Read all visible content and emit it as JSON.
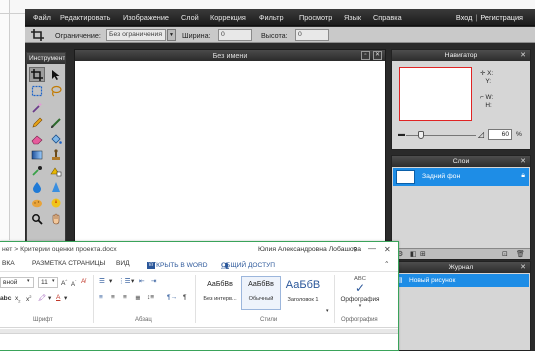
{
  "editor": {
    "menu": [
      "Файл",
      "Редактировать",
      "Изображение",
      "Слой",
      "Коррекция",
      "Фильтр",
      "Просмотр",
      "Язык",
      "Справка"
    ],
    "login": "Вход",
    "register": "Регистрация",
    "options": {
      "constraint_label": "Ограничение:",
      "constraint_value": "Без ограничения",
      "width_label": "Ширина:",
      "width_value": "0",
      "height_label": "Высота:",
      "height_value": "0"
    },
    "tools_title": "Инструменты",
    "canvas_title": "Без имени",
    "navigator": {
      "title": "Навигатор",
      "x_label": "X:",
      "y_label": "Y:",
      "w_label": "W:",
      "h_label": "H:",
      "zoom": "60",
      "pct": "%"
    },
    "layers": {
      "title": "Слои",
      "item": "Задний фон"
    },
    "journal": {
      "title": "Журнал",
      "item": "Новый рисунок"
    },
    "colors": {
      "accent": "#1e8de6",
      "frame": "#e02424"
    }
  },
  "word": {
    "doc_title": "нет > Критерии оценки проекта.docx",
    "user": "Юлия Александровна Лобашова",
    "help": "?",
    "tabs": [
      "ВКА",
      "РАЗМЕТКА СТРАНИЦЫ",
      "ВИД",
      "ОТКРЫТЬ В WORD",
      "ОБЩИЙ ДОСТУП"
    ],
    "font_name": "вной",
    "font_size": "11",
    "groups": {
      "font": "Шрифт",
      "paragraph": "Абзац",
      "styles": "Стили",
      "spelling": "Орфография"
    },
    "styles": [
      {
        "preview": "АаБбВв",
        "name": "Без интерв..."
      },
      {
        "preview": "АаБбВв",
        "name": "Обычный"
      },
      {
        "preview": "АаБбВ",
        "name": "Заголовок 1"
      }
    ],
    "spell_abc": "ABC",
    "spell_label": "Орфография"
  }
}
